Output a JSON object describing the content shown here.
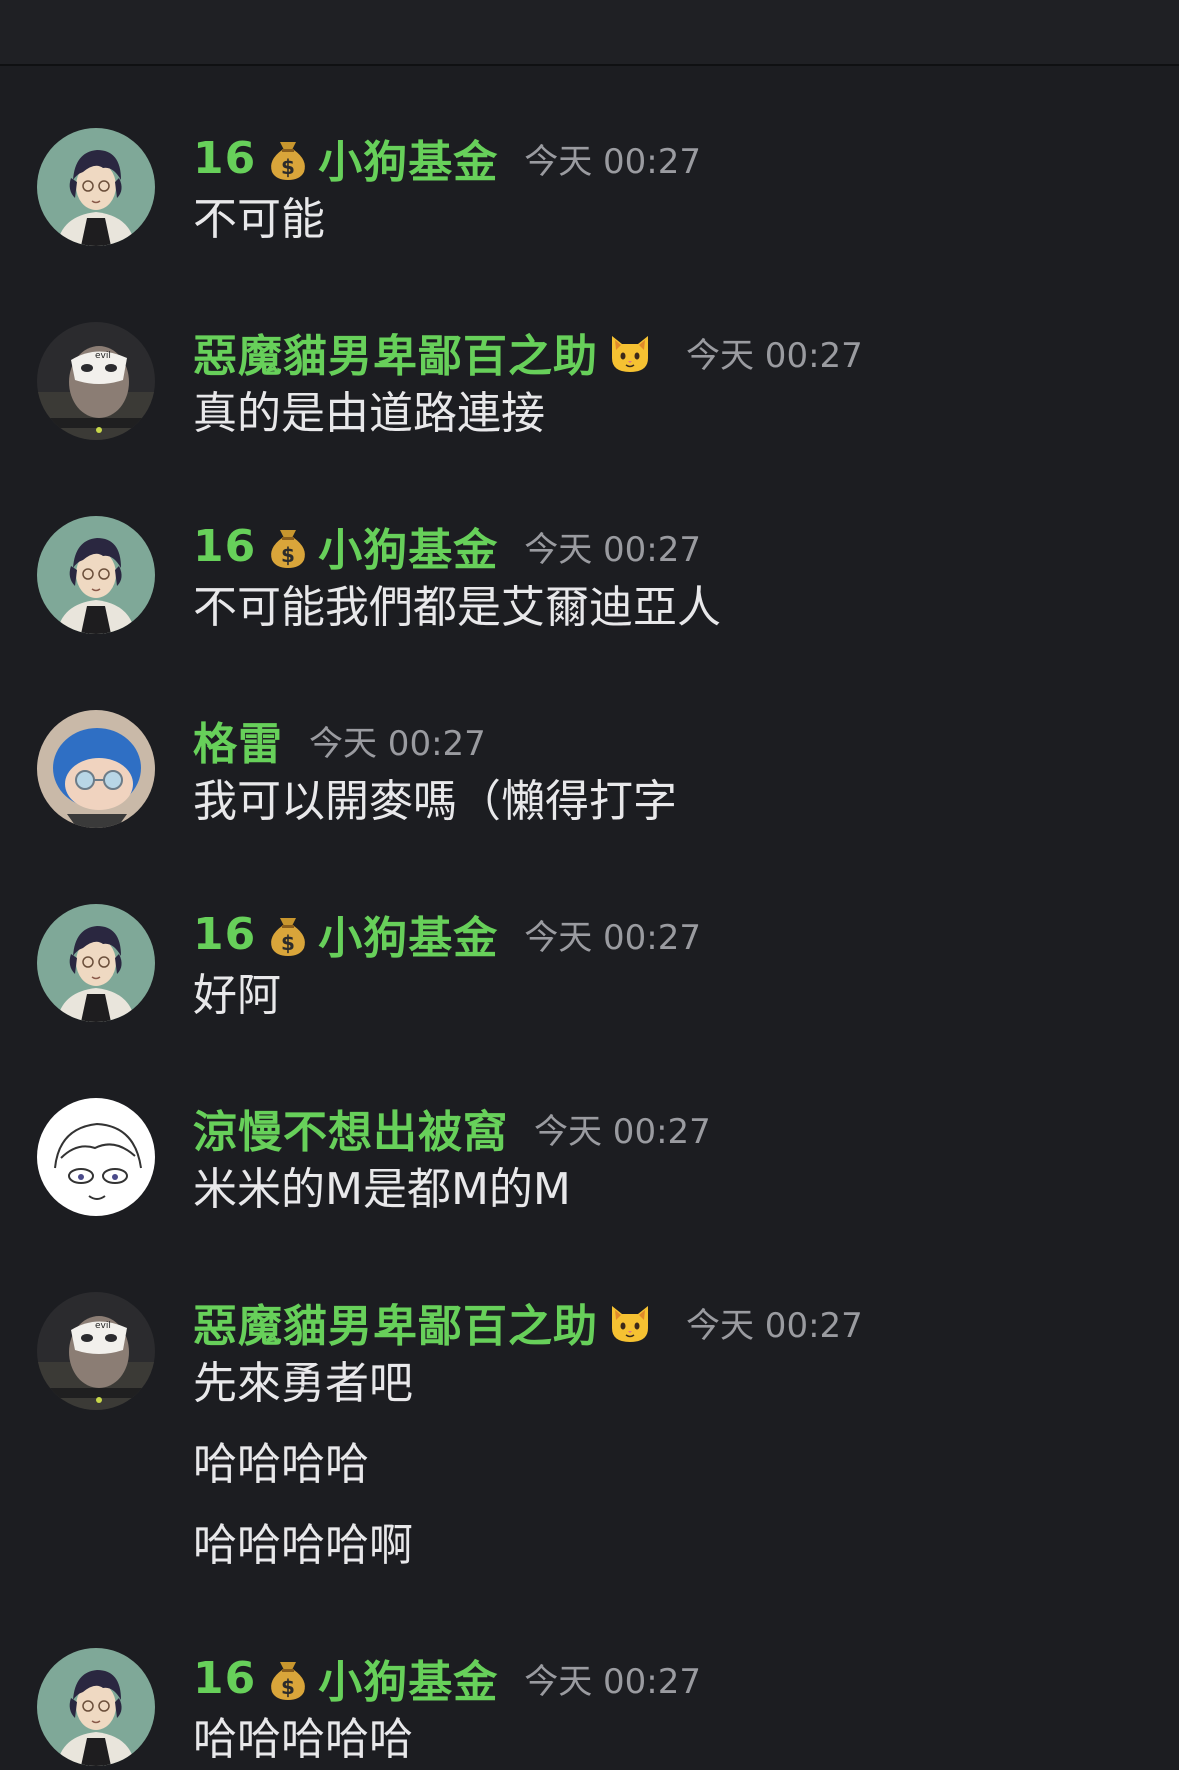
{
  "messages": [
    {
      "author": "16",
      "author_suffix": "小狗基金",
      "author_icon": "money-bag-icon",
      "time": "今天 00:27",
      "lines": [
        "不可能"
      ],
      "avatar": "boy"
    },
    {
      "author": "惡魔貓男卑鄙百之助",
      "author_suffix": "",
      "author_icon": "cat-face-icon",
      "time": "今天 00:27",
      "lines": [
        "真的是由道路連接"
      ],
      "avatar": "mask"
    },
    {
      "author": "16",
      "author_suffix": "小狗基金",
      "author_icon": "money-bag-icon",
      "time": "今天 00:27",
      "lines": [
        "不可能我們都是艾爾迪亞人"
      ],
      "avatar": "boy"
    },
    {
      "author": "格雷",
      "author_suffix": "",
      "author_icon": "",
      "time": "今天 00:27",
      "lines": [
        "我可以開麥嗎（懶得打字"
      ],
      "avatar": "plush"
    },
    {
      "author": "16",
      "author_suffix": "小狗基金",
      "author_icon": "money-bag-icon",
      "time": "今天 00:27",
      "lines": [
        "好阿"
      ],
      "avatar": "boy"
    },
    {
      "author": "涼慢不想出被窩",
      "author_suffix": "",
      "author_icon": "",
      "time": "今天 00:27",
      "lines": [
        "米米的M是都M的M"
      ],
      "avatar": "sketch"
    },
    {
      "author": "惡魔貓男卑鄙百之助",
      "author_suffix": "",
      "author_icon": "cat-face-icon",
      "time": "今天 00:27",
      "lines": [
        "先來勇者吧",
        "哈哈哈哈",
        "哈哈哈哈啊"
      ],
      "avatar": "mask"
    },
    {
      "author": "16",
      "author_suffix": "小狗基金",
      "author_icon": "money-bag-icon",
      "time": "今天 00:27",
      "lines": [
        "哈哈哈哈哈"
      ],
      "avatar": "boy"
    }
  ],
  "colors": {
    "background": "#1c1d21",
    "username": "#67d05a",
    "timestamp": "#9a9ba0",
    "message_text": "#e8e8ea"
  }
}
